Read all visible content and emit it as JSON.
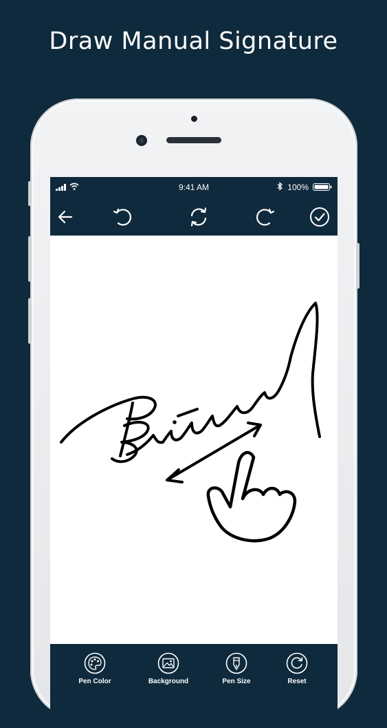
{
  "headline": "Draw Manual Signature",
  "status_bar": {
    "time": "9:41 AM",
    "battery": "100%"
  },
  "toolbar": {
    "icons": [
      "back-arrow-icon",
      "undo-icon",
      "refresh-icon",
      "redo-icon",
      "check-circle-icon"
    ]
  },
  "signature": {
    "name": "Britney"
  },
  "bottom_bar": {
    "items": [
      {
        "label": "Pen Color",
        "icon": "palette-icon"
      },
      {
        "label": "Background",
        "icon": "image-icon"
      },
      {
        "label": "Pen Size",
        "icon": "pen-nib-icon"
      },
      {
        "label": "Reset",
        "icon": "reset-icon"
      }
    ]
  },
  "colors": {
    "primary_dark": "#0f2a3c",
    "canvas": "#ffffff",
    "ink": "#000000"
  }
}
